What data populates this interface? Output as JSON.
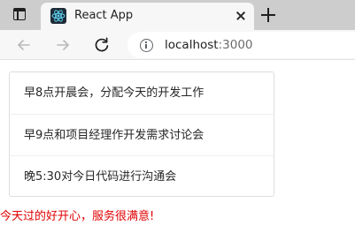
{
  "browser": {
    "tab": {
      "title": "React App"
    },
    "address": {
      "host": "localhost",
      "port": ":3000"
    }
  },
  "page": {
    "schedule": [
      {
        "text": "早8点开晨会，分配今天的开发工作"
      },
      {
        "text": "早9点和项目经理作开发需求讨论会"
      },
      {
        "text": "晚5:30对今日代码进行沟通会"
      }
    ],
    "message": "今天过的好开心，服务很满意!"
  }
}
